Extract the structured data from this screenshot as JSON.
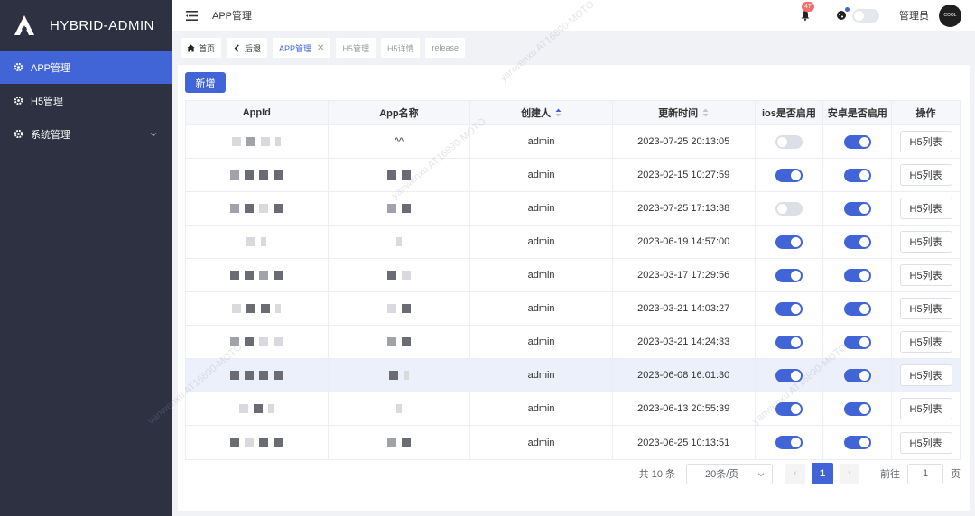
{
  "app": {
    "brand": "HYBRID-ADMIN"
  },
  "sidebar": {
    "items": [
      {
        "label": "APP管理",
        "icon": "gear-icon",
        "active": true
      },
      {
        "label": "H5管理",
        "icon": "gear-icon",
        "active": false
      },
      {
        "label": "系统管理",
        "icon": "gear-icon",
        "active": false,
        "has_children": true
      }
    ]
  },
  "header": {
    "title": "APP管理",
    "notification_count": "47",
    "username": "管理员",
    "avatar_text": "COOL"
  },
  "tabs": [
    {
      "label": "首页",
      "icon": "home-icon"
    },
    {
      "label": "后退",
      "icon": "back-icon"
    },
    {
      "label": "APP管理",
      "active": true,
      "closable": true
    },
    {
      "label": "H5管理"
    },
    {
      "label": "H5详情"
    },
    {
      "label": "release"
    }
  ],
  "toolbar": {
    "add_label": "新增"
  },
  "table": {
    "columns": [
      "AppId",
      "App名称",
      "创建人",
      "更新时间",
      "ios是否启用",
      "安卓是否启用",
      "操作"
    ],
    "action_label": "H5列表",
    "rows": [
      {
        "creator": "admin",
        "updated": "2023-07-25 20:13:05",
        "ios": false,
        "android": true,
        "app_name_text": "^^"
      },
      {
        "creator": "admin",
        "updated": "2023-02-15 10:27:59",
        "ios": true,
        "android": true
      },
      {
        "creator": "admin",
        "updated": "2023-07-25 17:13:38",
        "ios": false,
        "android": true
      },
      {
        "creator": "admin",
        "updated": "2023-06-19 14:57:00",
        "ios": true,
        "android": true
      },
      {
        "creator": "admin",
        "updated": "2023-03-17 17:29:56",
        "ios": true,
        "android": true
      },
      {
        "creator": "admin",
        "updated": "2023-03-21 14:03:27",
        "ios": true,
        "android": true
      },
      {
        "creator": "admin",
        "updated": "2023-03-21 14:24:33",
        "ios": true,
        "android": true
      },
      {
        "creator": "admin",
        "updated": "2023-06-08 16:01:30",
        "ios": true,
        "android": true,
        "highlight": true
      },
      {
        "creator": "admin",
        "updated": "2023-06-13 20:55:39",
        "ios": true,
        "android": true
      },
      {
        "creator": "admin",
        "updated": "2023-06-25 10:13:51",
        "ios": true,
        "android": true
      }
    ]
  },
  "pagination": {
    "total_label": "共 10 条",
    "page_size_label": "20条/页",
    "current_page": "1",
    "goto_prefix": "前往",
    "goto_value": "1",
    "goto_suffix": "页"
  },
  "watermark": "yanwenxu AT16890-MOTO",
  "colors": {
    "primary": "#4165d7",
    "sidebar": "#2d3142"
  }
}
